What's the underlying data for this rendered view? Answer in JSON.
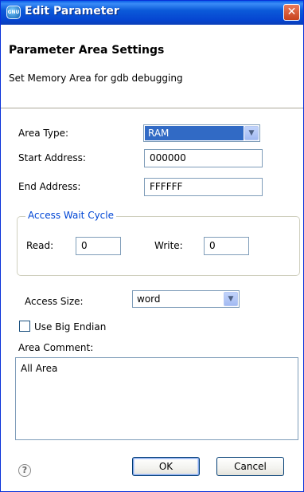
{
  "window": {
    "title": "Edit Parameter",
    "app_icon_text": "GNU",
    "close_glyph": "✕"
  },
  "header": {
    "title": "Parameter Area Settings",
    "description": "Set Memory Area for gdb debugging"
  },
  "form": {
    "area_type": {
      "label": "Area Type:",
      "value": "RAM"
    },
    "start_address": {
      "label": "Start Address:",
      "value": "000000"
    },
    "end_address": {
      "label": "End Address:",
      "value": "FFFFFF"
    },
    "access_wait_cycle": {
      "title": "Access Wait Cycle",
      "read": {
        "label": "Read:",
        "value": "0"
      },
      "write": {
        "label": "Write:",
        "value": "0"
      }
    },
    "access_size": {
      "label": "Access Size:",
      "value": "word"
    },
    "big_endian": {
      "label": "Use Big Endian",
      "checked": false
    },
    "area_comment": {
      "label": "Area Comment:",
      "value": "All Area"
    }
  },
  "footer": {
    "help_glyph": "?",
    "ok_label": "OK",
    "cancel_label": "Cancel"
  },
  "colors": {
    "titlebar": "#0645d1",
    "selection": "#316ac5",
    "group_title": "#0046d5"
  }
}
